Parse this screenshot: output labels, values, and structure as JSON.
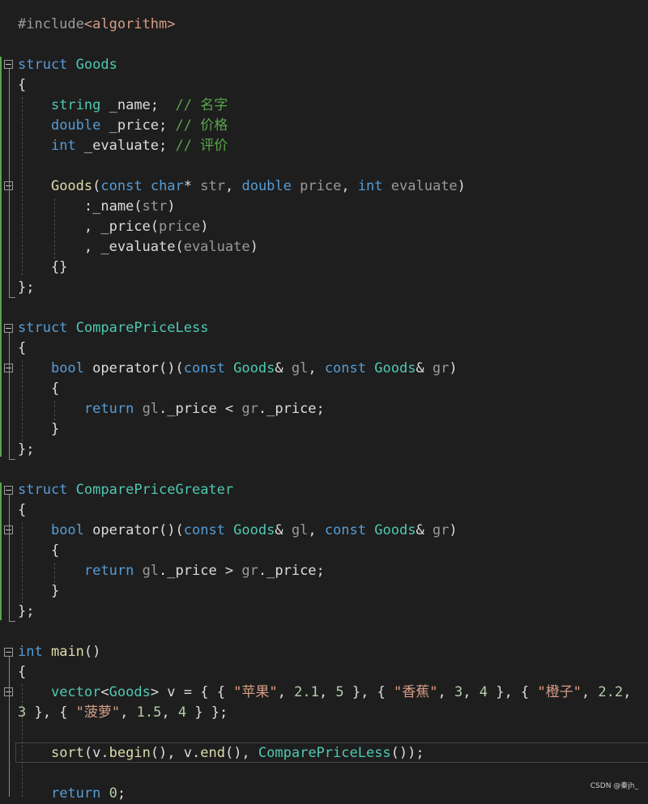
{
  "editor": {
    "lines": [
      [
        [
          "t-preproc",
          "#include"
        ],
        [
          "t-include",
          "<algorithm>"
        ]
      ],
      [],
      [
        [
          "t-keyword",
          "struct"
        ],
        [
          "t-plain",
          " "
        ],
        [
          "t-type",
          "Goods"
        ]
      ],
      [
        [
          "t-plain",
          "{"
        ]
      ],
      [
        [
          "t-plain",
          "    "
        ],
        [
          "t-type",
          "string"
        ],
        [
          "t-plain",
          " _name;  "
        ],
        [
          "t-comment",
          "// 名字"
        ]
      ],
      [
        [
          "t-plain",
          "    "
        ],
        [
          "t-keyword",
          "double"
        ],
        [
          "t-plain",
          " _price; "
        ],
        [
          "t-comment",
          "// 价格"
        ]
      ],
      [
        [
          "t-plain",
          "    "
        ],
        [
          "t-keyword",
          "int"
        ],
        [
          "t-plain",
          " _evaluate; "
        ],
        [
          "t-comment",
          "// 评价"
        ]
      ],
      [],
      [
        [
          "t-plain",
          "    "
        ],
        [
          "t-func",
          "Goods"
        ],
        [
          "t-plain",
          "("
        ],
        [
          "t-keyword",
          "const"
        ],
        [
          "t-plain",
          " "
        ],
        [
          "t-keyword",
          "char"
        ],
        [
          "t-plain",
          "* "
        ],
        [
          "t-param",
          "str"
        ],
        [
          "t-plain",
          ", "
        ],
        [
          "t-keyword",
          "double"
        ],
        [
          "t-plain",
          " "
        ],
        [
          "t-param",
          "price"
        ],
        [
          "t-plain",
          ", "
        ],
        [
          "t-keyword",
          "int"
        ],
        [
          "t-plain",
          " "
        ],
        [
          "t-param",
          "evaluate"
        ],
        [
          "t-plain",
          ")"
        ]
      ],
      [
        [
          "t-plain",
          "        :_name("
        ],
        [
          "t-param",
          "str"
        ],
        [
          "t-plain",
          ")"
        ]
      ],
      [
        [
          "t-plain",
          "        , _price("
        ],
        [
          "t-param",
          "price"
        ],
        [
          "t-plain",
          ")"
        ]
      ],
      [
        [
          "t-plain",
          "        , _evaluate("
        ],
        [
          "t-param",
          "evaluate"
        ],
        [
          "t-plain",
          ")"
        ]
      ],
      [
        [
          "t-plain",
          "    {}"
        ]
      ],
      [
        [
          "t-plain",
          "};"
        ]
      ],
      [],
      [
        [
          "t-keyword",
          "struct"
        ],
        [
          "t-plain",
          " "
        ],
        [
          "t-type",
          "ComparePriceLess"
        ]
      ],
      [
        [
          "t-plain",
          "{"
        ]
      ],
      [
        [
          "t-plain",
          "    "
        ],
        [
          "t-keyword",
          "bool"
        ],
        [
          "t-plain",
          " operator()("
        ],
        [
          "t-keyword",
          "const"
        ],
        [
          "t-plain",
          " "
        ],
        [
          "t-type",
          "Goods"
        ],
        [
          "t-plain",
          "& "
        ],
        [
          "t-param",
          "gl"
        ],
        [
          "t-plain",
          ", "
        ],
        [
          "t-keyword",
          "const"
        ],
        [
          "t-plain",
          " "
        ],
        [
          "t-type",
          "Goods"
        ],
        [
          "t-plain",
          "& "
        ],
        [
          "t-param",
          "gr"
        ],
        [
          "t-plain",
          ")"
        ]
      ],
      [
        [
          "t-plain",
          "    {"
        ]
      ],
      [
        [
          "t-plain",
          "        "
        ],
        [
          "t-keyword",
          "return"
        ],
        [
          "t-plain",
          " "
        ],
        [
          "t-param",
          "gl"
        ],
        [
          "t-plain",
          "._price < "
        ],
        [
          "t-param",
          "gr"
        ],
        [
          "t-plain",
          "._price;"
        ]
      ],
      [
        [
          "t-plain",
          "    }"
        ]
      ],
      [
        [
          "t-plain",
          "};"
        ]
      ],
      [],
      [
        [
          "t-keyword",
          "struct"
        ],
        [
          "t-plain",
          " "
        ],
        [
          "t-type",
          "ComparePriceGreater"
        ]
      ],
      [
        [
          "t-plain",
          "{"
        ]
      ],
      [
        [
          "t-plain",
          "    "
        ],
        [
          "t-keyword",
          "bool"
        ],
        [
          "t-plain",
          " operator()("
        ],
        [
          "t-keyword",
          "const"
        ],
        [
          "t-plain",
          " "
        ],
        [
          "t-type",
          "Goods"
        ],
        [
          "t-plain",
          "& "
        ],
        [
          "t-param",
          "gl"
        ],
        [
          "t-plain",
          ", "
        ],
        [
          "t-keyword",
          "const"
        ],
        [
          "t-plain",
          " "
        ],
        [
          "t-type",
          "Goods"
        ],
        [
          "t-plain",
          "& "
        ],
        [
          "t-param",
          "gr"
        ],
        [
          "t-plain",
          ")"
        ]
      ],
      [
        [
          "t-plain",
          "    {"
        ]
      ],
      [
        [
          "t-plain",
          "        "
        ],
        [
          "t-keyword",
          "return"
        ],
        [
          "t-plain",
          " "
        ],
        [
          "t-param",
          "gl"
        ],
        [
          "t-plain",
          "._price > "
        ],
        [
          "t-param",
          "gr"
        ],
        [
          "t-plain",
          "._price;"
        ]
      ],
      [
        [
          "t-plain",
          "    }"
        ]
      ],
      [
        [
          "t-plain",
          "};"
        ]
      ],
      [],
      [
        [
          "t-keyword",
          "int"
        ],
        [
          "t-plain",
          " "
        ],
        [
          "t-func",
          "main"
        ],
        [
          "t-plain",
          "()"
        ]
      ],
      [
        [
          "t-plain",
          "{"
        ]
      ],
      [
        [
          "t-plain",
          "    "
        ],
        [
          "t-type",
          "vector"
        ],
        [
          "t-plain",
          "<"
        ],
        [
          "t-type",
          "Goods"
        ],
        [
          "t-plain",
          "> v = { { "
        ],
        [
          "t-string",
          "\"苹果\""
        ],
        [
          "t-plain",
          ", "
        ],
        [
          "t-number",
          "2.1"
        ],
        [
          "t-plain",
          ", "
        ],
        [
          "t-number",
          "5"
        ],
        [
          "t-plain",
          " }, { "
        ],
        [
          "t-string",
          "\"香蕉\""
        ],
        [
          "t-plain",
          ", "
        ],
        [
          "t-number",
          "3"
        ],
        [
          "t-plain",
          ", "
        ],
        [
          "t-number",
          "4"
        ],
        [
          "t-plain",
          " }, { "
        ],
        [
          "t-string",
          "\"橙子\""
        ],
        [
          "t-plain",
          ", "
        ],
        [
          "t-number",
          "2.2"
        ],
        [
          "t-plain",
          ","
        ]
      ],
      [
        [
          "t-number",
          "3"
        ],
        [
          "t-plain",
          " }, { "
        ],
        [
          "t-string",
          "\"菠萝\""
        ],
        [
          "t-plain",
          ", "
        ],
        [
          "t-number",
          "1.5"
        ],
        [
          "t-plain",
          ", "
        ],
        [
          "t-number",
          "4"
        ],
        [
          "t-plain",
          " } };"
        ]
      ],
      [],
      [
        [
          "t-plain",
          "    "
        ],
        [
          "t-func",
          "sort"
        ],
        [
          "t-plain",
          "(v."
        ],
        [
          "t-func",
          "begin"
        ],
        [
          "t-plain",
          "(), v."
        ],
        [
          "t-func",
          "end"
        ],
        [
          "t-plain",
          "(), "
        ],
        [
          "t-type",
          "ComparePriceLess"
        ],
        [
          "t-plain",
          "());"
        ]
      ],
      [],
      [
        [
          "t-plain",
          "    "
        ],
        [
          "t-keyword",
          "return"
        ],
        [
          "t-plain",
          " "
        ],
        [
          "t-number",
          "0"
        ],
        [
          "t-plain",
          ";"
        ]
      ]
    ]
  },
  "watermark": "CSDN @秦jh_"
}
